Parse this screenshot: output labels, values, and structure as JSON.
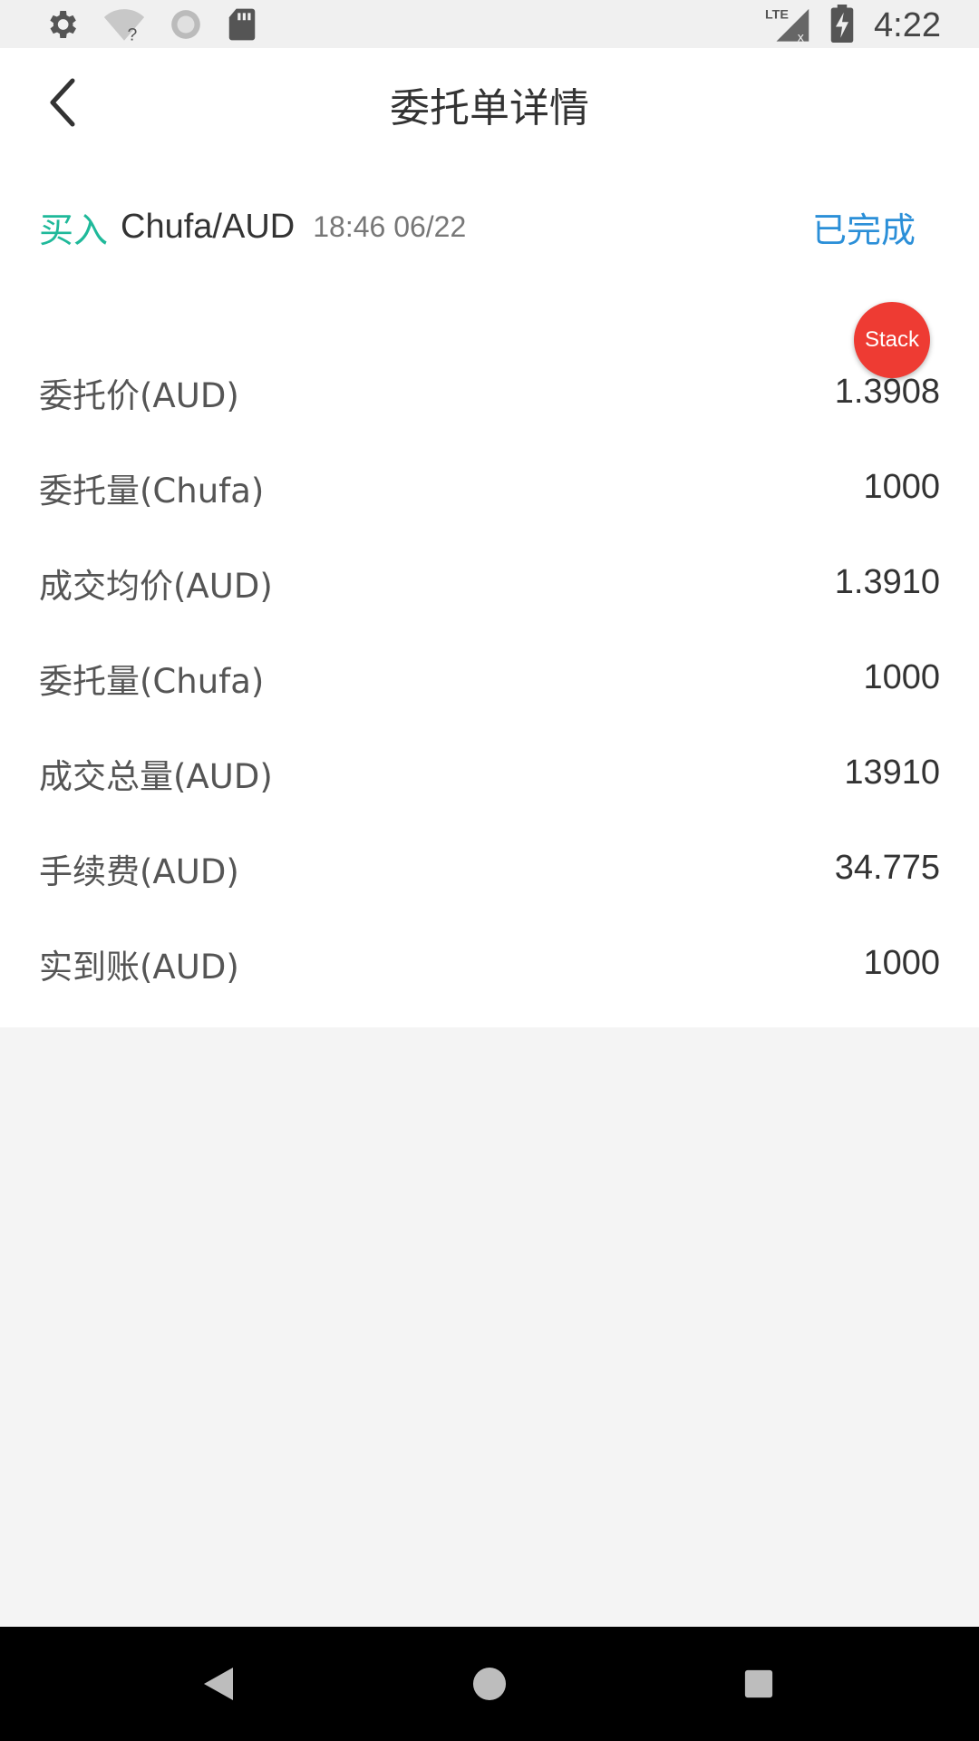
{
  "status_bar": {
    "time": "4:22",
    "network": "LTE",
    "icons": [
      "gear-icon",
      "wifi-unknown-icon",
      "sync-icon",
      "sd-card-icon",
      "lte-signal-icon",
      "battery-charging-icon"
    ]
  },
  "header": {
    "title": "委托单详情",
    "back_icon": "chevron-left-icon"
  },
  "order": {
    "side": "买入",
    "pair": "Chufa/AUD",
    "time": "18:46 06/22",
    "status": "已完成"
  },
  "details": [
    {
      "label": "委托价(AUD)",
      "value": "1.3908"
    },
    {
      "label": "委托量(Chufa)",
      "value": "1000"
    },
    {
      "label": "成交均价(AUD)",
      "value": "1.3910"
    },
    {
      "label": "委托量(Chufa)",
      "value": "1000"
    },
    {
      "label": "成交总量(AUD)",
      "value": "13910"
    },
    {
      "label": "手续费(AUD)",
      "value": "34.775"
    },
    {
      "label": "实到账(AUD)",
      "value": "1000"
    }
  ],
  "fab": {
    "label": "Stack"
  },
  "colors": {
    "buy": "#1fb99a",
    "status": "#2b8fd8",
    "fab": "#ee3b33"
  },
  "nav_bar": {
    "icons": [
      "back-triangle-icon",
      "home-circle-icon",
      "recents-square-icon"
    ]
  }
}
